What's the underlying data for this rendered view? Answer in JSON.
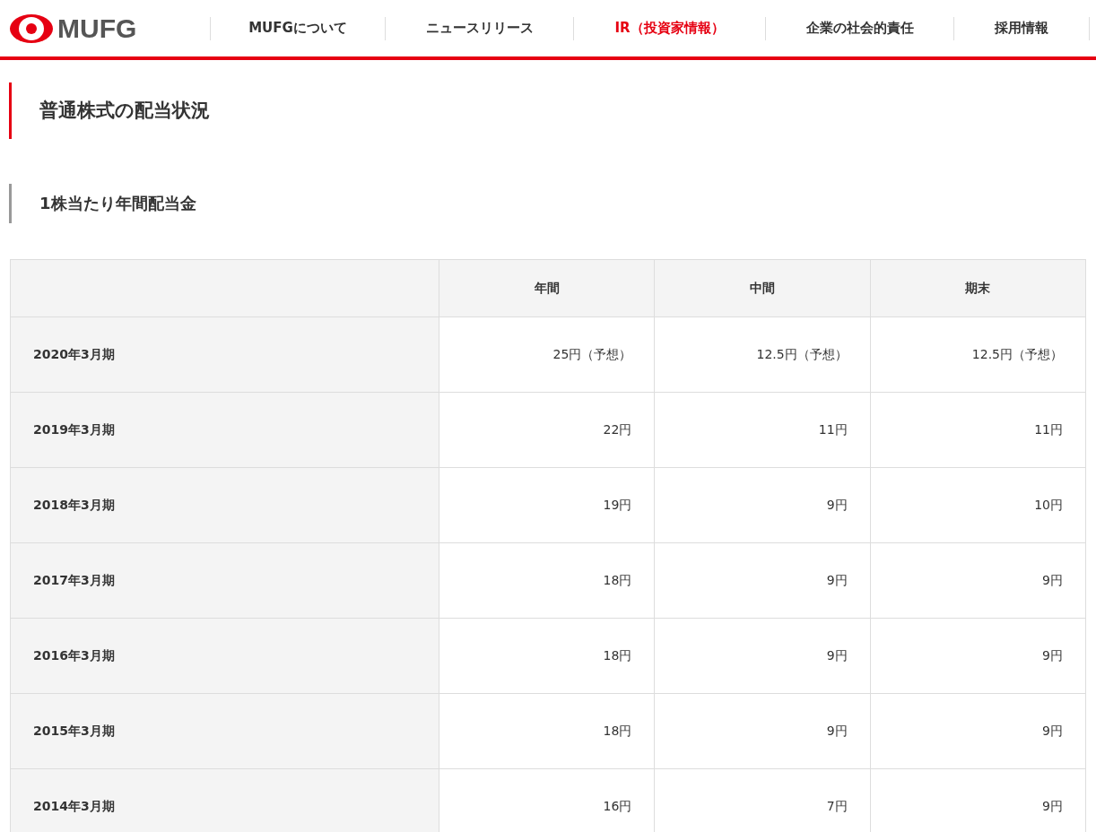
{
  "header": {
    "logo_text": "MUFG",
    "nav": [
      {
        "label": "MUFGについて",
        "selected": false
      },
      {
        "label": "ニュースリリース",
        "selected": false
      },
      {
        "label": "IR（投資家情報）",
        "selected": true
      },
      {
        "label": "企業の社会的責任",
        "selected": false
      },
      {
        "label": "採用情報",
        "selected": false
      }
    ]
  },
  "page_title": "普通株式の配当状況",
  "section_title": "1株当たり年間配当金",
  "table": {
    "columns": [
      "年間",
      "中間",
      "期末"
    ],
    "rows": [
      {
        "period": "2020年3月期",
        "cells": [
          "25円（予想）",
          "12.5円（予想）",
          "12.5円（予想）"
        ]
      },
      {
        "period": "2019年3月期",
        "cells": [
          "22円",
          "11円",
          "11円"
        ]
      },
      {
        "period": "2018年3月期",
        "cells": [
          "19円",
          "9円",
          "10円"
        ]
      },
      {
        "period": "2017年3月期",
        "cells": [
          "18円",
          "9円",
          "9円"
        ]
      },
      {
        "period": "2016年3月期",
        "cells": [
          "18円",
          "9円",
          "9円"
        ]
      },
      {
        "period": "2015年3月期",
        "cells": [
          "18円",
          "9円",
          "9円"
        ]
      },
      {
        "period": "2014年3月期",
        "cells": [
          "16円",
          "7円",
          "9円"
        ]
      }
    ]
  }
}
